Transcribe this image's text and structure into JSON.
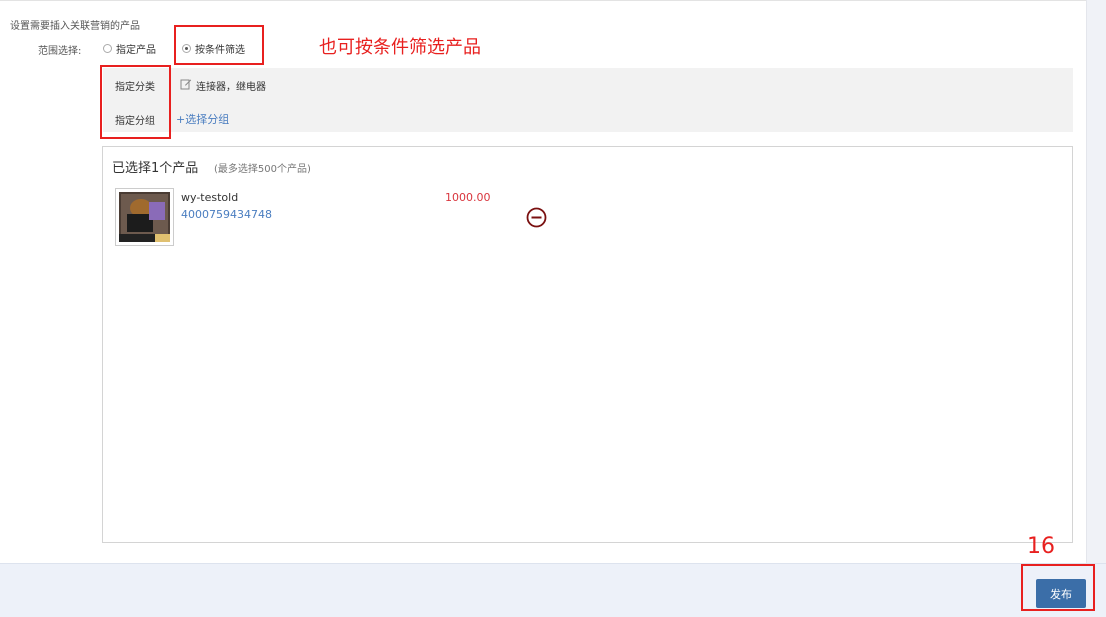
{
  "intro": "设置需要插入关联营销的产品",
  "range": {
    "label": "范围选择:",
    "options": [
      "指定产品",
      "按条件筛选"
    ],
    "selected": "按条件筛选"
  },
  "annotation": "也可按条件筛选产品",
  "filter": {
    "category_label": "指定分类",
    "category_value": "连接器，继电器",
    "group_label": "指定分组",
    "choose_group_link": "+选择分组"
  },
  "selected": {
    "title": "已选择1个产品",
    "limit_note": "(最多选择500个产品)",
    "products": [
      {
        "name": "wy-testold",
        "id": "4000759434748",
        "price": "1000.00"
      }
    ]
  },
  "step_number": "16",
  "publish_label": "发布",
  "colors": {
    "accent_red": "#e8201f",
    "link_blue": "#4a7dc0",
    "price_red": "#d9363e",
    "button_blue": "#3b6ea8"
  },
  "icons": {
    "edit": "edit-icon",
    "remove": "minus-circle-icon"
  }
}
